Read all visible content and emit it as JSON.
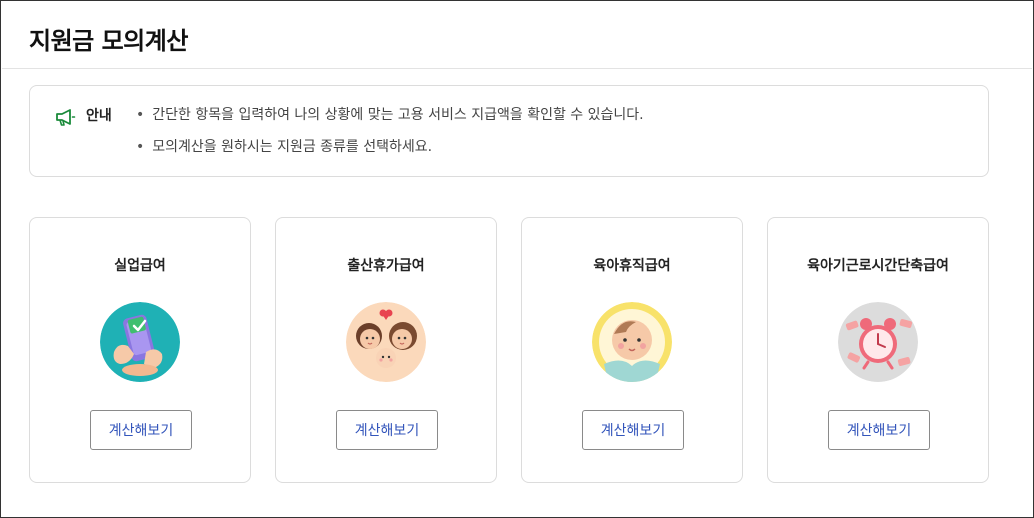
{
  "page": {
    "title": "지원금 모의계산"
  },
  "notice": {
    "label": "안내",
    "icon": "megaphone-icon",
    "items": [
      "간단한 항목을 입력하여 나의 상황에 맞는 고용 서비스 지급액을 확인할 수 있습니다.",
      "모의계산을 원하시는 지원금 종류를 선택하세요."
    ]
  },
  "cards": [
    {
      "title": "실업급여",
      "button": "계산해보기",
      "icon": "phone-check-illustration",
      "bg": "#1fb1b5"
    },
    {
      "title": "출산휴가급여",
      "button": "계산해보기",
      "icon": "family-illustration",
      "bg": "#fbd9bb"
    },
    {
      "title": "육아휴직급여",
      "button": "계산해보기",
      "icon": "baby-illustration",
      "bg": "#f8e26a"
    },
    {
      "title": "육아기근로시간단축급여",
      "button": "계산해보기",
      "icon": "alarm-clock-illustration",
      "bg": "#dcdcdc"
    }
  ],
  "colors": {
    "accent_button_text": "#3355bb",
    "notice_icon": "#1a8a3a"
  }
}
